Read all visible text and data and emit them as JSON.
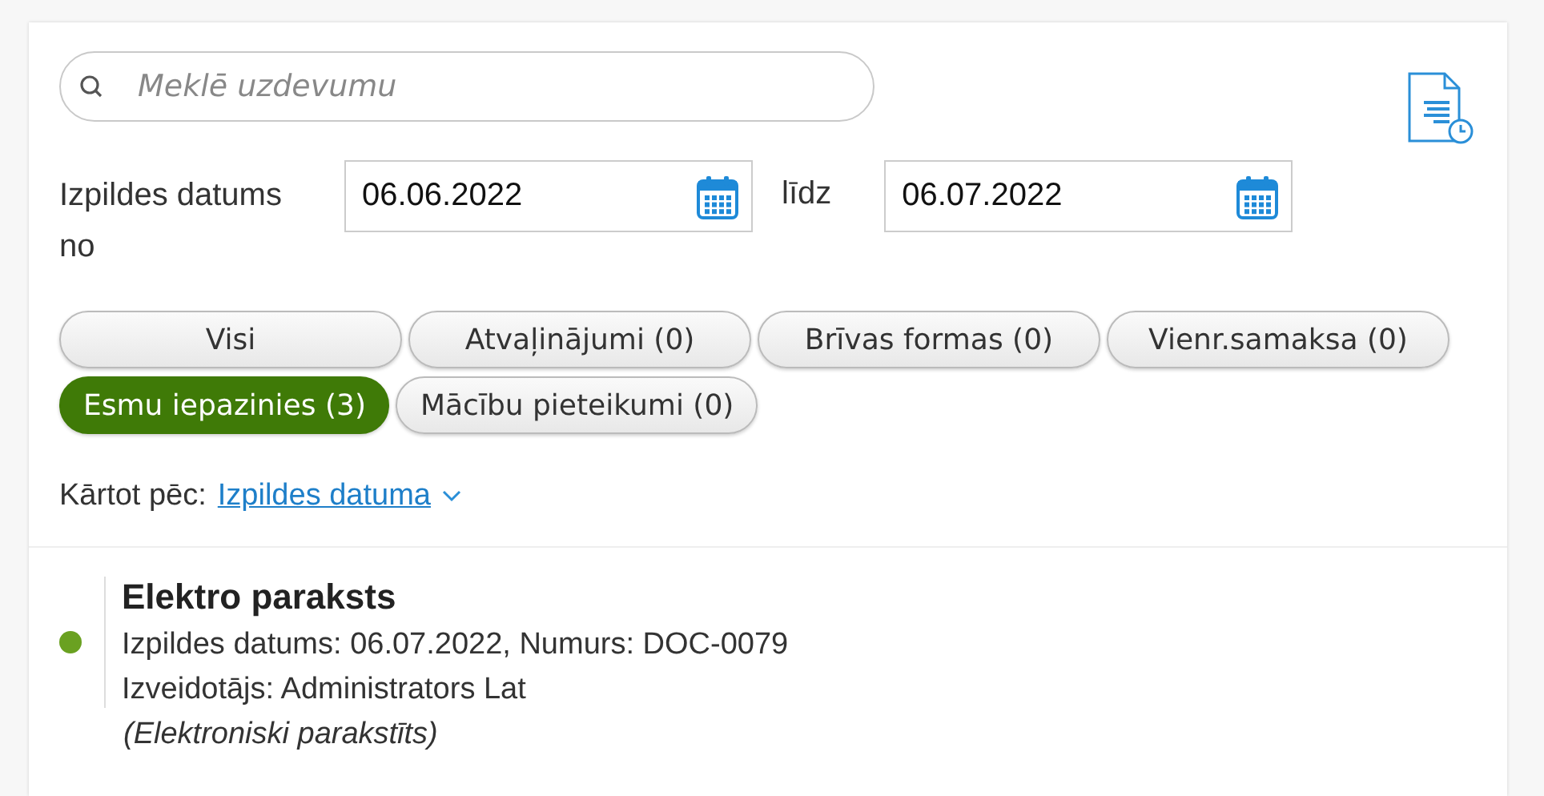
{
  "search": {
    "placeholder": "Meklē uzdevumu"
  },
  "date_filter": {
    "label": "Izpildes datums no",
    "from": "06.06.2022",
    "to_label": "līdz",
    "to": "06.07.2022"
  },
  "filters": [
    {
      "label": "Visi",
      "selected": false
    },
    {
      "label": "Atvaļinājumi (0)",
      "selected": false
    },
    {
      "label": "Brīvas formas (0)",
      "selected": false
    },
    {
      "label": "Vienr.samaksa (0)",
      "selected": false
    },
    {
      "label": "Esmu iepazinies (3)",
      "selected": true
    },
    {
      "label": "Mācību pieteikumi (0)",
      "selected": false
    }
  ],
  "sort": {
    "label": "Kārtot pēc:",
    "value": "Izpildes datuma"
  },
  "tasks": [
    {
      "title": "Elektro paraksts",
      "details": "Izpildes datums: 06.07.2022, Numurs: DOC-0079",
      "creator": "Izveidotājs: Administrators Lat",
      "note": "(Elektroniski parakstīts)",
      "color": "#6aa121"
    }
  ]
}
